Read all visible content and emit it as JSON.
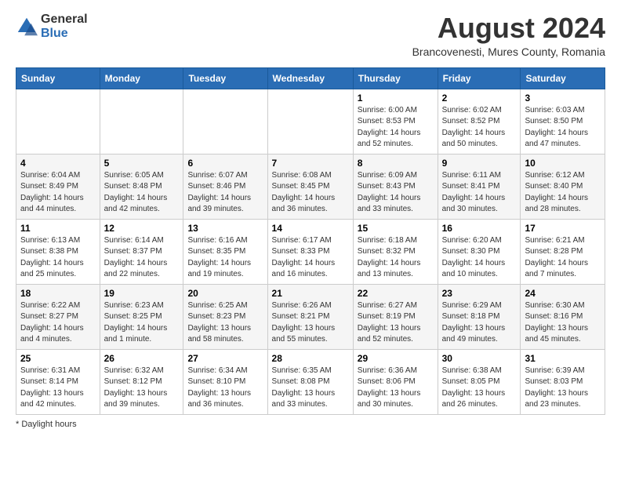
{
  "header": {
    "logo_general": "General",
    "logo_blue": "Blue",
    "month_year": "August 2024",
    "location": "Brancovenesti, Mures County, Romania"
  },
  "days_of_week": [
    "Sunday",
    "Monday",
    "Tuesday",
    "Wednesday",
    "Thursday",
    "Friday",
    "Saturday"
  ],
  "footer": {
    "note": "* Daylight hours"
  },
  "weeks": [
    [
      {
        "day": "",
        "info": ""
      },
      {
        "day": "",
        "info": ""
      },
      {
        "day": "",
        "info": ""
      },
      {
        "day": "",
        "info": ""
      },
      {
        "day": "1",
        "info": "Sunrise: 6:00 AM\nSunset: 8:53 PM\nDaylight: 14 hours\nand 52 minutes."
      },
      {
        "day": "2",
        "info": "Sunrise: 6:02 AM\nSunset: 8:52 PM\nDaylight: 14 hours\nand 50 minutes."
      },
      {
        "day": "3",
        "info": "Sunrise: 6:03 AM\nSunset: 8:50 PM\nDaylight: 14 hours\nand 47 minutes."
      }
    ],
    [
      {
        "day": "4",
        "info": "Sunrise: 6:04 AM\nSunset: 8:49 PM\nDaylight: 14 hours\nand 44 minutes."
      },
      {
        "day": "5",
        "info": "Sunrise: 6:05 AM\nSunset: 8:48 PM\nDaylight: 14 hours\nand 42 minutes."
      },
      {
        "day": "6",
        "info": "Sunrise: 6:07 AM\nSunset: 8:46 PM\nDaylight: 14 hours\nand 39 minutes."
      },
      {
        "day": "7",
        "info": "Sunrise: 6:08 AM\nSunset: 8:45 PM\nDaylight: 14 hours\nand 36 minutes."
      },
      {
        "day": "8",
        "info": "Sunrise: 6:09 AM\nSunset: 8:43 PM\nDaylight: 14 hours\nand 33 minutes."
      },
      {
        "day": "9",
        "info": "Sunrise: 6:11 AM\nSunset: 8:41 PM\nDaylight: 14 hours\nand 30 minutes."
      },
      {
        "day": "10",
        "info": "Sunrise: 6:12 AM\nSunset: 8:40 PM\nDaylight: 14 hours\nand 28 minutes."
      }
    ],
    [
      {
        "day": "11",
        "info": "Sunrise: 6:13 AM\nSunset: 8:38 PM\nDaylight: 14 hours\nand 25 minutes."
      },
      {
        "day": "12",
        "info": "Sunrise: 6:14 AM\nSunset: 8:37 PM\nDaylight: 14 hours\nand 22 minutes."
      },
      {
        "day": "13",
        "info": "Sunrise: 6:16 AM\nSunset: 8:35 PM\nDaylight: 14 hours\nand 19 minutes."
      },
      {
        "day": "14",
        "info": "Sunrise: 6:17 AM\nSunset: 8:33 PM\nDaylight: 14 hours\nand 16 minutes."
      },
      {
        "day": "15",
        "info": "Sunrise: 6:18 AM\nSunset: 8:32 PM\nDaylight: 14 hours\nand 13 minutes."
      },
      {
        "day": "16",
        "info": "Sunrise: 6:20 AM\nSunset: 8:30 PM\nDaylight: 14 hours\nand 10 minutes."
      },
      {
        "day": "17",
        "info": "Sunrise: 6:21 AM\nSunset: 8:28 PM\nDaylight: 14 hours\nand 7 minutes."
      }
    ],
    [
      {
        "day": "18",
        "info": "Sunrise: 6:22 AM\nSunset: 8:27 PM\nDaylight: 14 hours\nand 4 minutes."
      },
      {
        "day": "19",
        "info": "Sunrise: 6:23 AM\nSunset: 8:25 PM\nDaylight: 14 hours\nand 1 minute."
      },
      {
        "day": "20",
        "info": "Sunrise: 6:25 AM\nSunset: 8:23 PM\nDaylight: 13 hours\nand 58 minutes."
      },
      {
        "day": "21",
        "info": "Sunrise: 6:26 AM\nSunset: 8:21 PM\nDaylight: 13 hours\nand 55 minutes."
      },
      {
        "day": "22",
        "info": "Sunrise: 6:27 AM\nSunset: 8:19 PM\nDaylight: 13 hours\nand 52 minutes."
      },
      {
        "day": "23",
        "info": "Sunrise: 6:29 AM\nSunset: 8:18 PM\nDaylight: 13 hours\nand 49 minutes."
      },
      {
        "day": "24",
        "info": "Sunrise: 6:30 AM\nSunset: 8:16 PM\nDaylight: 13 hours\nand 45 minutes."
      }
    ],
    [
      {
        "day": "25",
        "info": "Sunrise: 6:31 AM\nSunset: 8:14 PM\nDaylight: 13 hours\nand 42 minutes."
      },
      {
        "day": "26",
        "info": "Sunrise: 6:32 AM\nSunset: 8:12 PM\nDaylight: 13 hours\nand 39 minutes."
      },
      {
        "day": "27",
        "info": "Sunrise: 6:34 AM\nSunset: 8:10 PM\nDaylight: 13 hours\nand 36 minutes."
      },
      {
        "day": "28",
        "info": "Sunrise: 6:35 AM\nSunset: 8:08 PM\nDaylight: 13 hours\nand 33 minutes."
      },
      {
        "day": "29",
        "info": "Sunrise: 6:36 AM\nSunset: 8:06 PM\nDaylight: 13 hours\nand 30 minutes."
      },
      {
        "day": "30",
        "info": "Sunrise: 6:38 AM\nSunset: 8:05 PM\nDaylight: 13 hours\nand 26 minutes."
      },
      {
        "day": "31",
        "info": "Sunrise: 6:39 AM\nSunset: 8:03 PM\nDaylight: 13 hours\nand 23 minutes."
      }
    ]
  ]
}
